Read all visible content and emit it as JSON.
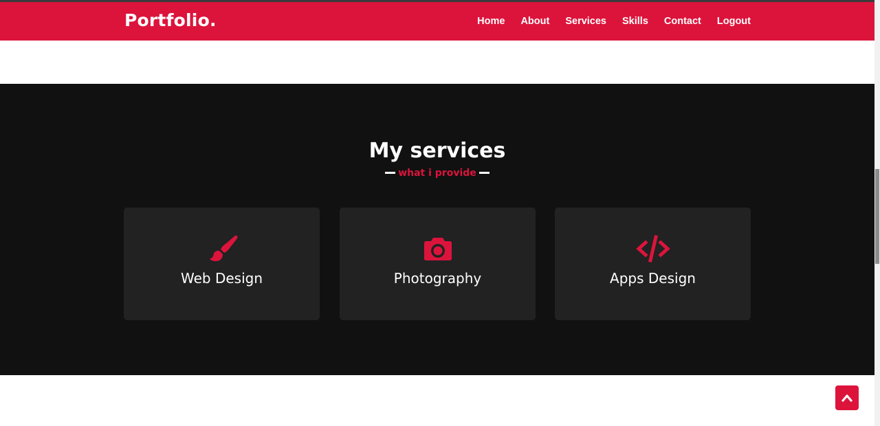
{
  "navbar": {
    "logo": "Portfolio.",
    "menu": [
      {
        "label": "Home"
      },
      {
        "label": "About"
      },
      {
        "label": "Services"
      },
      {
        "label": "Skills"
      },
      {
        "label": "Contact"
      },
      {
        "label": "Logout"
      }
    ]
  },
  "services": {
    "title": "My services",
    "subtitle": "what i provide",
    "cards": [
      {
        "title": "Web Design",
        "icon": "paintbrush-icon"
      },
      {
        "title": "Photography",
        "icon": "camera-icon"
      },
      {
        "title": "Apps Design",
        "icon": "code-icon"
      }
    ]
  },
  "colors": {
    "accent": "#dc143c",
    "section_bg": "#111111",
    "card_bg": "#222222",
    "text_light": "#ffffff"
  },
  "scroll_top_button": {
    "icon": "chevron-up-icon"
  }
}
